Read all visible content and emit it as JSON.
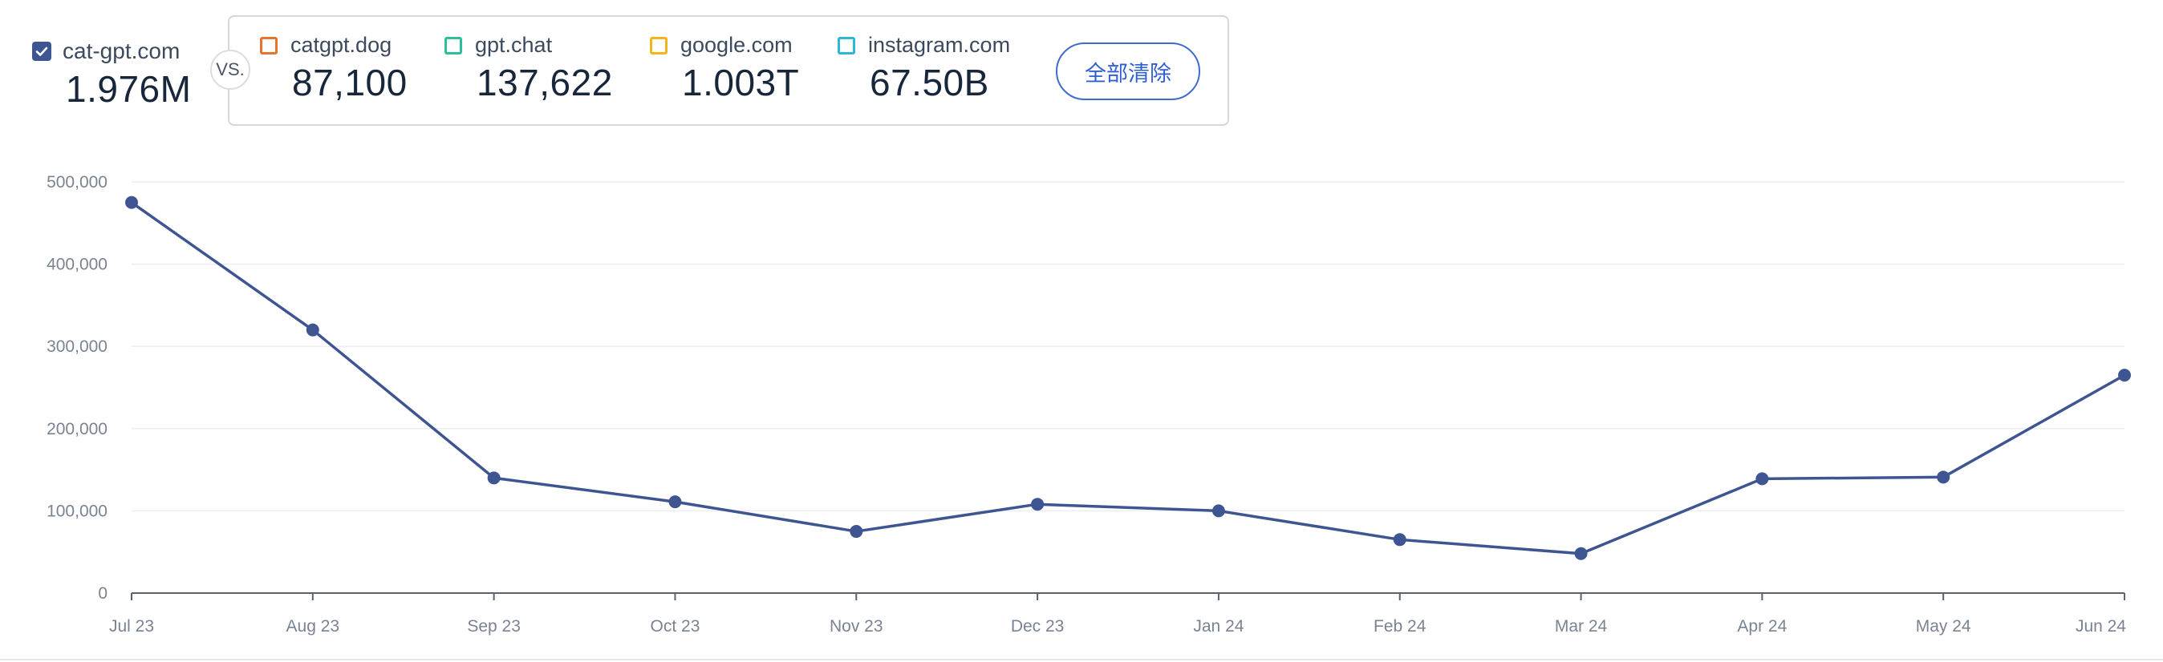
{
  "primary": {
    "name": "cat-gpt.com",
    "value": "1.976M",
    "color": "#3f5592",
    "checked": true
  },
  "vs_label": "VS.",
  "competitors": [
    {
      "name": "catgpt.dog",
      "value": "87,100",
      "color": "#e8742a",
      "checked": false
    },
    {
      "name": "gpt.chat",
      "value": "137,622",
      "color": "#2cbf9a",
      "checked": false
    },
    {
      "name": "google.com",
      "value": "1.003T",
      "color": "#f2b61a",
      "checked": false
    },
    {
      "name": "instagram.com",
      "value": "67.50B",
      "color": "#2ab8d6",
      "checked": false
    }
  ],
  "clear_all_label": "全部清除",
  "chart_data": {
    "type": "line",
    "categories": [
      "Jul 23",
      "Aug 23",
      "Sep 23",
      "Oct 23",
      "Nov 23",
      "Dec 23",
      "Jan 24",
      "Feb 24",
      "Mar 24",
      "Apr 24",
      "May 24",
      "Jun 24"
    ],
    "series": [
      {
        "name": "cat-gpt.com",
        "color": "#3f5592",
        "values": [
          475000,
          320000,
          140000,
          111000,
          75000,
          108000,
          100000,
          65000,
          48000,
          139000,
          141000,
          265000
        ]
      }
    ],
    "y_ticks": [
      "0",
      "100,000",
      "200,000",
      "300,000",
      "400,000",
      "500,000"
    ],
    "ylim": [
      0,
      500000
    ],
    "grid": true,
    "legend": "none"
  }
}
